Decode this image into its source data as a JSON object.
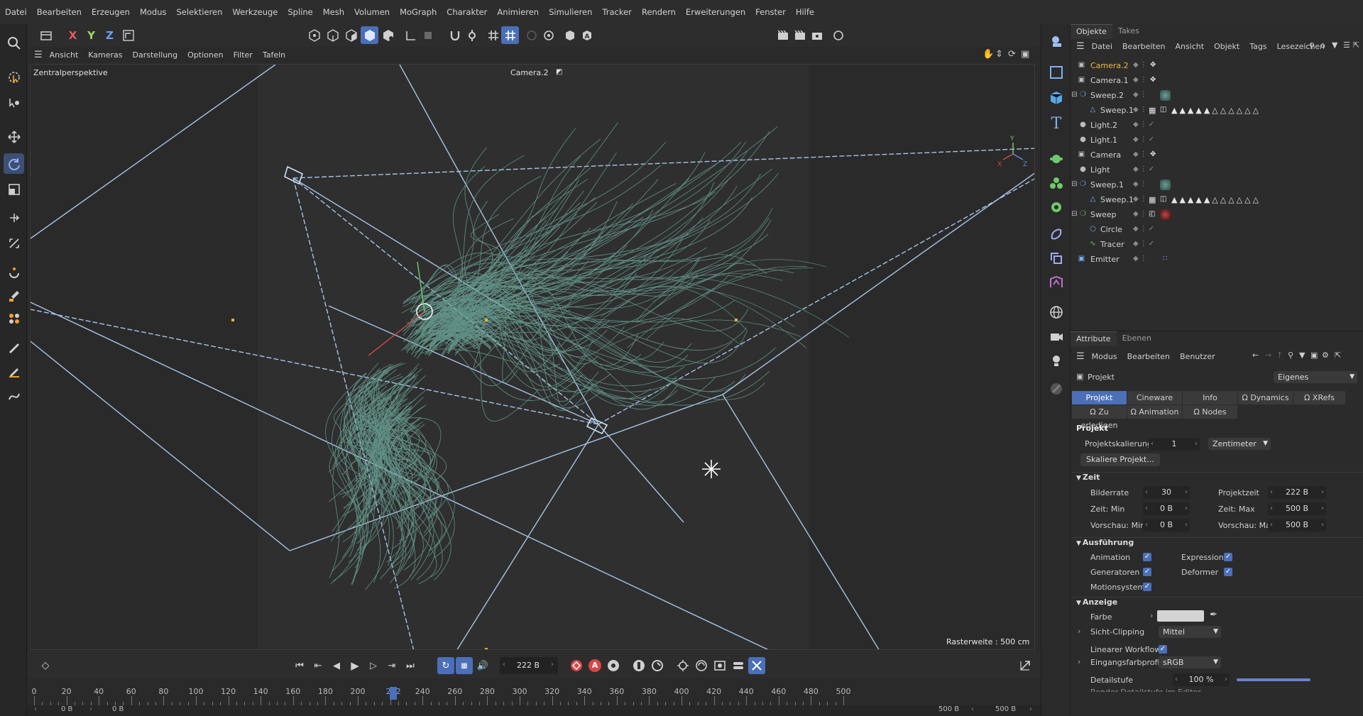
{
  "menubar": {
    "items": [
      "Datei",
      "Bearbeiten",
      "Erzeugen",
      "Modus",
      "Selektieren",
      "Werkzeuge",
      "Spline",
      "Mesh",
      "Volumen",
      "MoGraph",
      "Charakter",
      "Animieren",
      "Simulieren",
      "Tracker",
      "Rendern",
      "Erweiterungen",
      "Fenster",
      "Hilfe"
    ]
  },
  "toolbar": {
    "axis_x": "X",
    "axis_y": "Y",
    "axis_z": "Z"
  },
  "viewmenu": {
    "items": [
      "Ansicht",
      "Kameras",
      "Darstellung",
      "Optionen",
      "Filter",
      "Tafeln"
    ]
  },
  "viewport": {
    "name": "Zentralperspektive",
    "camera_label": "Camera.2",
    "grid_info": "Rasterweite : 500 cm",
    "hair_color": "#6aa295",
    "wire_color": "#a9c3e6"
  },
  "timeline": {
    "current_frame": "222 B",
    "record_a": "A",
    "ruler_labels": [
      "0",
      "20",
      "40",
      "60",
      "80",
      "100",
      "120",
      "140",
      "160",
      "180",
      "200",
      "222",
      "240",
      "260",
      "280",
      "300",
      "320",
      "340",
      "360",
      "380",
      "400",
      "420",
      "440",
      "460",
      "480",
      "500"
    ],
    "playhead_value": 222,
    "start_field": "0 B",
    "start_field2": "0 B",
    "end_field": "500 B",
    "end_field2": "500 B"
  },
  "objects": {
    "tabs": [
      "Objekte",
      "Takes"
    ],
    "menu": [
      "Datei",
      "Bearbeiten",
      "Ansicht",
      "Objekt",
      "Tags",
      "Lesezeichen"
    ],
    "items": [
      {
        "name": "Camera.2",
        "highlight": true
      },
      {
        "name": "Camera.1"
      },
      {
        "name": "Sweep.2"
      },
      {
        "name": "Sweep.1"
      },
      {
        "name": "Light.2"
      },
      {
        "name": "Light.1"
      },
      {
        "name": "Camera"
      },
      {
        "name": "Light"
      },
      {
        "name": "Sweep.1"
      },
      {
        "name": "Sweep.1"
      },
      {
        "name": "Sweep"
      },
      {
        "name": "Circle"
      },
      {
        "name": "Tracer"
      },
      {
        "name": "Emitter"
      }
    ]
  },
  "attributes": {
    "tabs": [
      "Attribute",
      "Ebenen"
    ],
    "menu": [
      "Modus",
      "Bearbeiten",
      "Benutzer"
    ],
    "object": "Projekt",
    "preset": "Eigenes",
    "tabrow1": [
      "Projekt",
      "Cineware",
      "Info",
      "Dynamics",
      "XRefs"
    ],
    "tabrow2": [
      "Zu erledigen",
      "Animation",
      "Nodes"
    ],
    "section_title": "Projekt",
    "projektskalierung_label": "Projektskalierung",
    "projektskalierung_value": "1",
    "unit": "Zentimeter",
    "scale_button": "Skaliere Projekt...",
    "zeit": {
      "title": "Zeit",
      "bilderrate_label": "Bilderrate",
      "bilderrate": "30",
      "projektzeit_label": "Projektzeit",
      "projektzeit": "222 B",
      "zeit_min_label": "Zeit: Min",
      "zeit_min": "0 B",
      "zeit_max_label": "Zeit: Max",
      "zeit_max": "500 B",
      "vorschau_min_label": "Vorschau: Min",
      "vorschau_min": "0 B",
      "vorschau_max_label": "Vorschau: Max",
      "vorschau_max": "500 B"
    },
    "ausfuehrung": {
      "title": "Ausführung",
      "animation": "Animation",
      "expressions": "Expressions",
      "generatoren": "Generatoren",
      "deformer": "Deformer",
      "motionsystem": "Motionsystem"
    },
    "anzeige": {
      "title": "Anzeige",
      "farbe": "Farbe",
      "farbe_value": "#d4d4d4",
      "sicht_clipping": "Sicht-Clipping",
      "sicht_clipping_value": "Mittel",
      "linearer_workflow": "Linearer Workflow",
      "eingangsfarbprofil": "Eingangsfarbprofil",
      "eingangsfarbprofil_value": "sRGB",
      "detailstufe": "Detailstufe",
      "detailstufe_value": "100 %",
      "detailstufe_level": 1.0,
      "render_detail": "Render-Detailstufe im Editor"
    }
  },
  "colors": {
    "accent": "#4b6fb8",
    "highlight_text": "#f0b83c"
  }
}
